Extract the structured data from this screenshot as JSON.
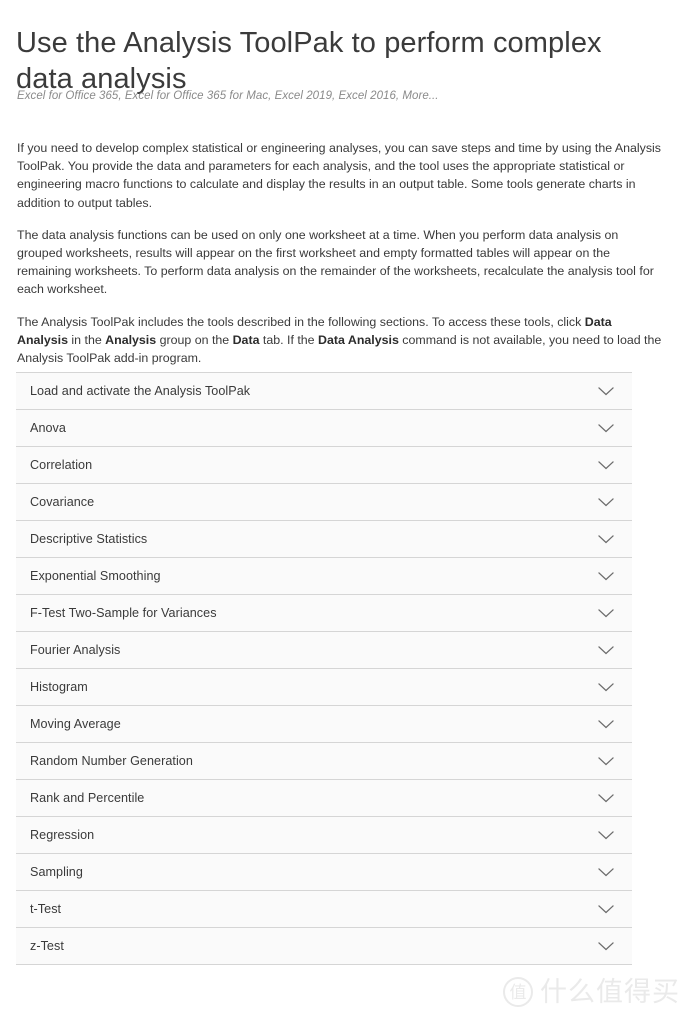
{
  "article": {
    "title": "Use the Analysis ToolPak to perform complex data analysis",
    "applies_to": "Excel for Office 365, Excel for Office 365 for Mac, Excel 2019, Excel 2016, More...",
    "paragraphs": {
      "p1": "If you need to develop complex statistical or engineering analyses, you can save steps and time by using the Analysis ToolPak. You provide the data and parameters for each analysis, and the tool uses the appropriate statistical or engineering macro functions to calculate and display the results in an output table. Some tools generate charts in addition to output tables.",
      "p2": "The data analysis functions can be used on only one worksheet at a time. When you perform data analysis on grouped worksheets, results will appear on the first worksheet and empty formatted tables will appear on the remaining worksheets. To perform data analysis on the remainder of the worksheets, recalculate the analysis tool for each worksheet.",
      "p3": {
        "seg1": "The Analysis ToolPak includes the tools described in the following sections. To access these tools, click ",
        "bold1": "Data Analysis",
        "seg2": " in the ",
        "bold2": "Analysis",
        "seg3": " group on the ",
        "bold3": "Data",
        "seg4": " tab. If the ",
        "bold4": "Data Analysis",
        "seg5": " command is not available, you need to load the Analysis ToolPak add-in program."
      }
    }
  },
  "accordion": {
    "expand_icon": "chevron-down-icon",
    "items": [
      {
        "label": "Load and activate the Analysis ToolPak"
      },
      {
        "label": "Anova"
      },
      {
        "label": "Correlation"
      },
      {
        "label": "Covariance"
      },
      {
        "label": "Descriptive Statistics"
      },
      {
        "label": "Exponential Smoothing"
      },
      {
        "label": "F-Test Two-Sample for Variances"
      },
      {
        "label": "Fourier Analysis"
      },
      {
        "label": "Histogram"
      },
      {
        "label": "Moving Average"
      },
      {
        "label": "Random Number Generation"
      },
      {
        "label": "Rank and Percentile"
      },
      {
        "label": "Regression"
      },
      {
        "label": "Sampling"
      },
      {
        "label": "t-Test"
      },
      {
        "label": "z-Test"
      }
    ]
  },
  "watermark": {
    "logo_glyph": "值",
    "text": "什么值得买"
  },
  "colors": {
    "page_background": "#ffffff",
    "title_text": "#3b3b3b",
    "body_text": "#3a3a3a",
    "muted_text": "#8a8a8a",
    "panel_background": "#fafafa",
    "divider": "#d5d5d5",
    "watermark": "#eaeaea"
  }
}
